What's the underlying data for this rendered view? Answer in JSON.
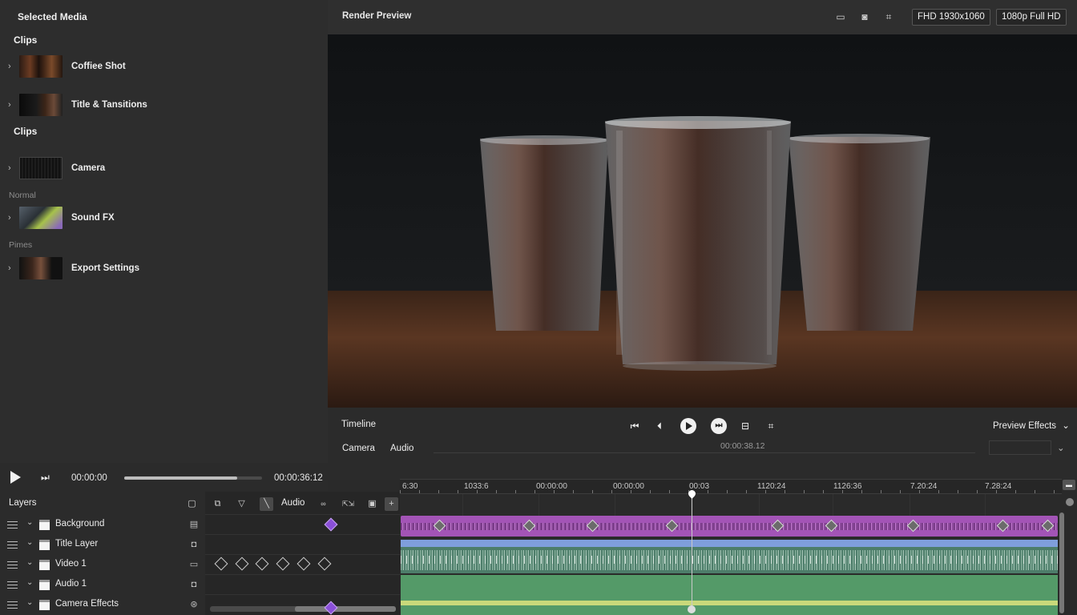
{
  "media": {
    "title": "Selected Media",
    "sections": [
      "Clips",
      "Clips"
    ],
    "groups": [
      "Normal",
      "Pimes"
    ],
    "items": [
      {
        "name": "Coffiee Shot"
      },
      {
        "name": "Title & Tansitions"
      },
      {
        "name": "Camera"
      },
      {
        "name": "Sound FX"
      },
      {
        "name": "Export Settings"
      }
    ]
  },
  "preview": {
    "title": "Render Preview",
    "resolution_a": "FHD 1930x1060",
    "resolution_b": "1080p Full HD"
  },
  "transport": {
    "timeline_label": "Timeline",
    "tab_camera": "Camera",
    "tab_audio": "Audio",
    "current_time": "00:00:38.12",
    "effects_label": "Preview Effects"
  },
  "playback": {
    "start_time": "00:00:00",
    "end_time": "00:00:36:12",
    "progress": 0.82
  },
  "ruler": {
    "labels": [
      "6:30",
      "1033:6",
      "00:00:00",
      "00:00:00",
      "00:03",
      "1120:24",
      "1126:36",
      "7.20:24",
      "7.28:24"
    ]
  },
  "layers": {
    "title": "Layers",
    "toolbar_audio": "Audio",
    "rows": [
      {
        "name": "Background"
      },
      {
        "name": "Title Layer"
      },
      {
        "name": "Video 1"
      },
      {
        "name": "Audio 1"
      },
      {
        "name": "Camera Effects"
      }
    ]
  },
  "colors": {
    "accent_purple": "#8a4fd8",
    "track_purple": "#a354b6",
    "track_blue": "#7f9edc",
    "track_audio": "#4d7d6a",
    "track_green": "#549a68"
  }
}
